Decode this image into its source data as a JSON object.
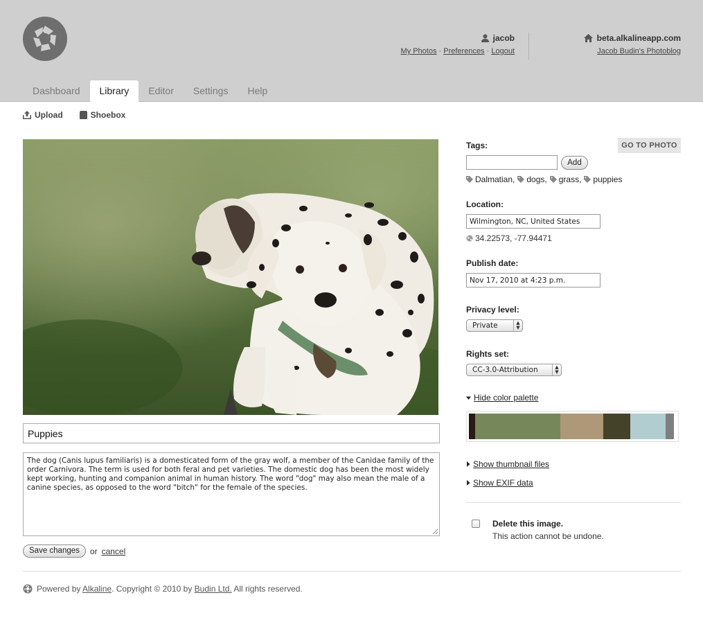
{
  "header": {
    "user": {
      "name": "jacob",
      "links": [
        "My Photos",
        "Preferences",
        "Logout"
      ],
      "separator": " · "
    },
    "site": {
      "name": "beta.alkalineapp.com",
      "link": "Jacob Budin's Photoblog"
    }
  },
  "tabs": [
    {
      "label": "Dashboard",
      "active": false
    },
    {
      "label": "Library",
      "active": true
    },
    {
      "label": "Editor",
      "active": false
    },
    {
      "label": "Settings",
      "active": false
    },
    {
      "label": "Help",
      "active": false
    }
  ],
  "subnav": {
    "upload": "Upload",
    "shoebox": "Shoebox"
  },
  "photo": {
    "title": "Puppies",
    "description": "The dog (Canis lupus familiaris) is a domesticated form of the gray wolf, a member of the Canidae family of the order Carnivora. The term is used for both feral and pet varieties. The domestic dog has been the most widely kept working, hunting and companion animal in human history. The word \"dog\" may also mean the male of a canine species, as opposed to the word \"bitch\" for the female of the species."
  },
  "actions": {
    "save": "Save changes",
    "or": "or",
    "cancel": "cancel"
  },
  "sidebar": {
    "goto_photo": "GO TO PHOTO",
    "tags_label": "Tags:",
    "tag_input_value": "",
    "add_label": "Add",
    "tags": [
      "Dalmatian,",
      "dogs,",
      "grass,",
      "puppies"
    ],
    "location_label": "Location:",
    "location_value": "Wilmington, NC, United States",
    "coordinates": "34.22573, -77.94471",
    "publish_label": "Publish date:",
    "publish_value": "Nov 17, 2010 at 4:23 p.m.",
    "privacy_label": "Privacy level:",
    "privacy_value": "Private",
    "rights_label": "Rights set:",
    "rights_value": "CC-3.0-Attribution",
    "palette_toggle": "Hide color palette",
    "palette": [
      "#2a1a14",
      "#76885a",
      "#ad9877",
      "#444329",
      "#b1cdd0",
      "#7f7f7f"
    ],
    "palette_weights": [
      0.03,
      0.41,
      0.21,
      0.13,
      0.17,
      0.04
    ],
    "show_thumbnails": "Show thumbnail files",
    "show_exif": "Show EXIF data",
    "delete_title": "Delete this image.",
    "delete_note": "This action cannot be undone."
  },
  "footer": {
    "powered": "Powered by",
    "alkaline": "Alkaline",
    "copyright": ". Copyright © 2010 by",
    "company": "Budin Ltd.",
    "rights": "All rights reserved."
  }
}
